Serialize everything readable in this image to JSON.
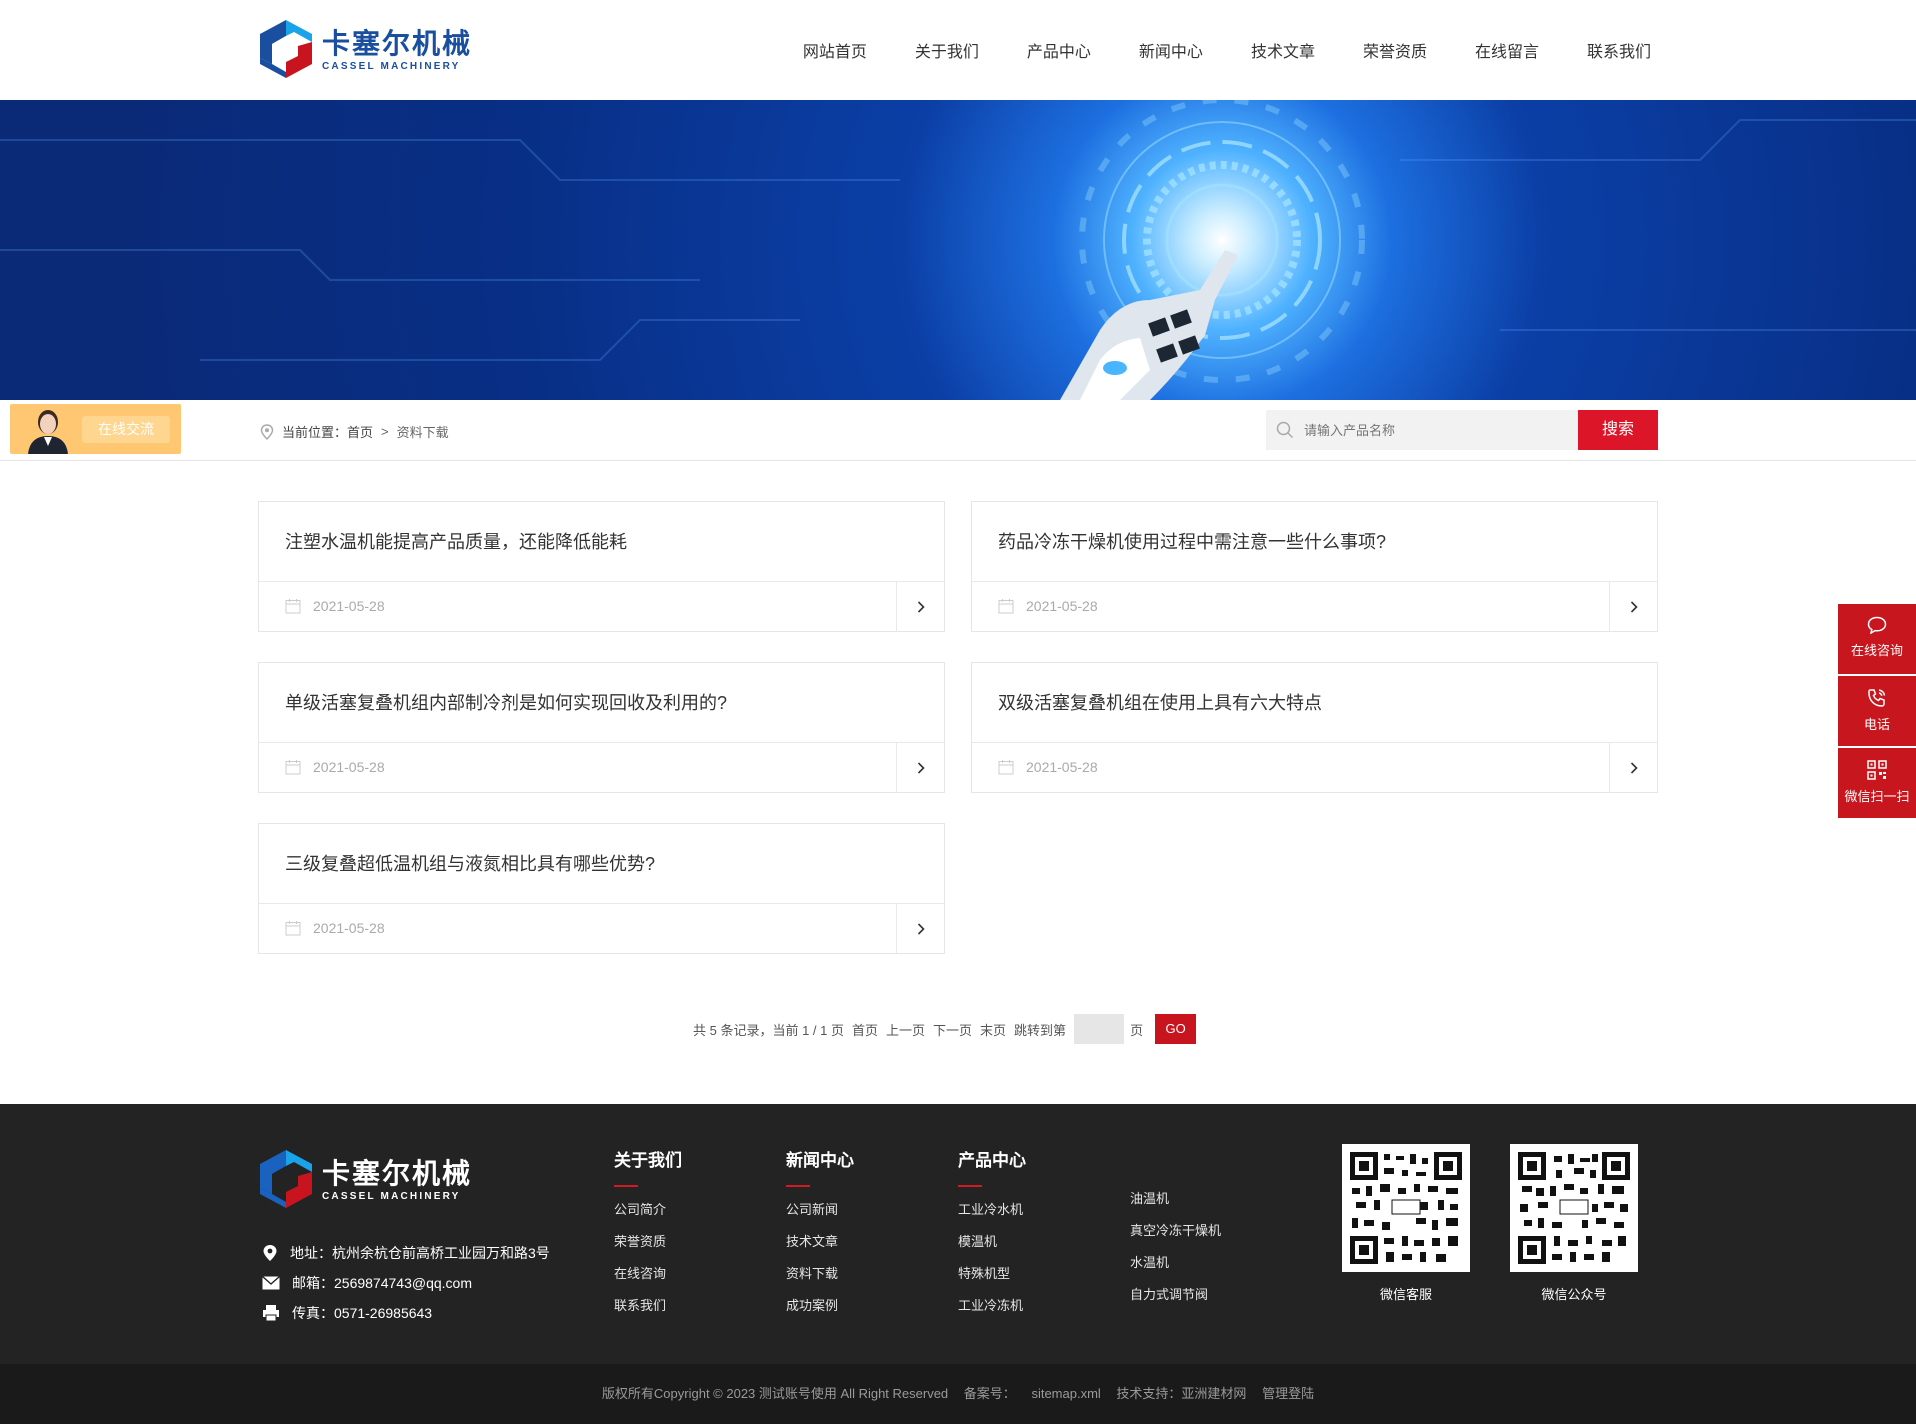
{
  "brand": {
    "name_cn": "卡塞尔机械",
    "name_en": "CASSEL MACHINERY",
    "blue": "#1a4fa0",
    "red": "#c8141f"
  },
  "nav": [
    "网站首页",
    "关于我们",
    "产品中心",
    "新闻中心",
    "技术文章",
    "荣誉资质",
    "在线留言",
    "联系我们"
  ],
  "chat_badge": {
    "label": "在线交流",
    "avatar_icon": "customer-service-avatar"
  },
  "breadcrumb": {
    "prefix": "当前位置：",
    "home": "首页",
    "separator": ">",
    "current": "资料下载"
  },
  "search": {
    "placeholder": "请输入产品名称",
    "button": "搜索"
  },
  "articles": [
    {
      "title": "注塑水温机能提高产品质量，还能降低能耗",
      "date": "2021-05-28"
    },
    {
      "title": "药品冷冻干燥机使用过程中需注意一些什么事项?",
      "date": "2021-05-28"
    },
    {
      "title": "单级活塞复叠机组内部制冷剂是如何实现回收及利用的?",
      "date": "2021-05-28"
    },
    {
      "title": "双级活塞复叠机组在使用上具有六大特点",
      "date": "2021-05-28"
    },
    {
      "title": "三级复叠超低温机组与液氮相比具有哪些优势?",
      "date": "2021-05-28"
    }
  ],
  "pagination": {
    "summary": "共 5 条记录，当前 1 / 1 页",
    "first": "首页",
    "prev": "上一页",
    "next": "下一页",
    "last": "末页",
    "jump_label": "跳转到第",
    "page_unit": "页",
    "go": "GO"
  },
  "footer": {
    "address": "地址：杭州余杭仓前高桥工业园万和路3号",
    "email": "邮箱：2569874743@qq.com",
    "fax": "传真：0571-26985643",
    "columns": [
      {
        "title": "关于我们",
        "links": [
          "公司简介",
          "荣誉资质",
          "在线咨询",
          "联系我们"
        ]
      },
      {
        "title": "新闻中心",
        "links": [
          "公司新闻",
          "技术文章",
          "资料下载",
          "成功案例"
        ]
      },
      {
        "title": "产品中心",
        "links": [
          "工业冷水机",
          "模温机",
          "特殊机型",
          "工业冷冻机"
        ]
      },
      {
        "title": "",
        "links": [
          "油温机",
          "真空冷冻干燥机",
          "水温机",
          "自力式调节阀"
        ]
      }
    ],
    "qrcodes": [
      {
        "caption": "微信客服"
      },
      {
        "caption": "微信公众号"
      }
    ]
  },
  "copyright": {
    "text": "版权所有Copyright © 2023 测试账号使用 All Right Reserved",
    "icp": "备案号：",
    "sitemap": "sitemap.xml",
    "support": "技术支持：亚洲建材网",
    "admin": "管理登陆"
  },
  "side_float": [
    {
      "label": "在线咨询",
      "icon": "chat-bubble-icon"
    },
    {
      "label": "电话",
      "icon": "phone-icon"
    },
    {
      "label": "微信扫一扫",
      "icon": "qrcode-icon"
    }
  ]
}
